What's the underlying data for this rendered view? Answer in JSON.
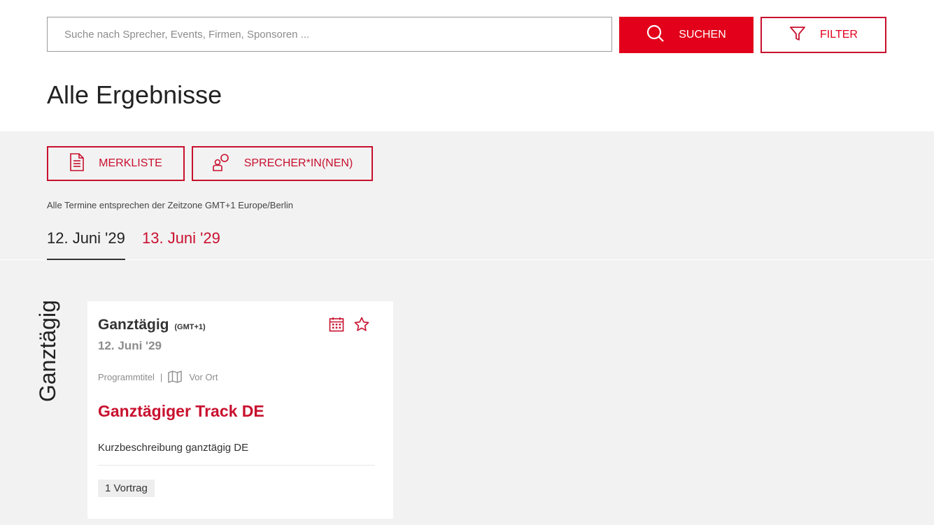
{
  "search": {
    "placeholder": "Suche nach Sprecher, Events, Firmen, Sponsoren ...",
    "button_label": "SUCHEN"
  },
  "filter": {
    "label": "FILTER"
  },
  "page_title": "Alle Ergebnisse",
  "actions": {
    "merkliste": "MERKLISTE",
    "speakers": "SPRECHER*IN(NEN)"
  },
  "timezone_note": "Alle Termine entsprechen der Zeitzone GMT+1 Europe/Berlin",
  "date_tabs": [
    {
      "label": "12. Juni '29",
      "active": true
    },
    {
      "label": "13. Juni '29",
      "active": false
    }
  ],
  "section_label": "Ganztägig",
  "card": {
    "time": "Ganztägig",
    "tz": "(GMT+1)",
    "date": "12. Juni '29",
    "program": "Programmtitel",
    "separator": "|",
    "location": "Vor Ort",
    "title": "Ganztägiger Track DE",
    "description": "Kurzbeschreibung ganztägig DE",
    "talk_count": "1 Vortrag"
  },
  "colors": {
    "accent": "#e2001a",
    "accent_dark": "#c8102e",
    "background": "#f2f2f2"
  },
  "icons": [
    "search-icon",
    "filter-icon",
    "document-icon",
    "speakers-icon",
    "calendar-icon",
    "star-icon",
    "map-icon"
  ]
}
